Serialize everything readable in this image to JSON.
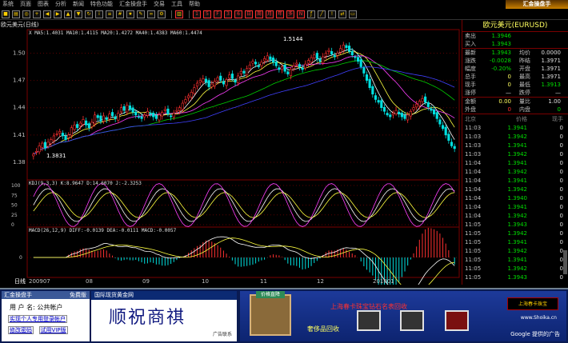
{
  "menu": {
    "items": [
      "系统",
      "页面",
      "图表",
      "分析",
      "新闻",
      "特色功能",
      "汇金操盘手",
      "交易",
      "工具",
      "帮助"
    ],
    "brand": "汇金操盘手"
  },
  "chart_title": "欧元美元(日线)",
  "chart_data": {
    "type": "candlestick",
    "title": "欧元美元(日线)",
    "main_indicator": {
      "label": "X  MA5:1.4031  MA10:1.4115  MA20:1.4272  MA40:1.4383  MA60:1.4474",
      "ma5_label": "MA5:1.4031",
      "ma10_label": "MA10:1.4115",
      "ma20_label": "MA20:1.4272",
      "ma40_label": "MA40:1.4383",
      "ma60_label": "MA60:1.4474"
    },
    "y_ticks": [
      "1.50",
      "1.47",
      "1.44",
      "1.41",
      "1.38"
    ],
    "y_values": [
      1.5,
      1.47,
      1.44,
      1.41,
      1.38
    ],
    "ylim": [
      1.365,
      1.518
    ],
    "high_label": "1.5144",
    "low_label": "1.3831",
    "high": 1.5144,
    "low": 1.3831,
    "x_labels": [
      "日线",
      "200907",
      "08",
      "09",
      "10",
      "11",
      "12",
      "201001"
    ],
    "kdj": {
      "label": "KDJ(9,3,3)  K:8.9647  D:14.6070  J:-2.3253",
      "y_ticks": [
        "100",
        "75",
        "50",
        "25",
        "0"
      ]
    },
    "macd": {
      "label": "MACD(26,12,9)  DIFF:-0.0139  DEA:-0.0111  MACD:-0.0057",
      "y_ticks": [
        "0"
      ]
    },
    "series_close": [
      1.389,
      1.392,
      1.398,
      1.401,
      1.396,
      1.402,
      1.405,
      1.409,
      1.411,
      1.414,
      1.409,
      1.405,
      1.41,
      1.418,
      1.421,
      1.418,
      1.423,
      1.427,
      1.421,
      1.418,
      1.424,
      1.432,
      1.429,
      1.425,
      1.431,
      1.427,
      1.433,
      1.431,
      1.428,
      1.434,
      1.44,
      1.437,
      1.443,
      1.438,
      1.435,
      1.432,
      1.43,
      1.428,
      1.432,
      1.436,
      1.433,
      1.43,
      1.428,
      1.432,
      1.435,
      1.438,
      1.433,
      1.43,
      1.434,
      1.437,
      1.44,
      1.445,
      1.449,
      1.453,
      1.457,
      1.462,
      1.467,
      1.47,
      1.472,
      1.468,
      1.463,
      1.466,
      1.469,
      1.473,
      1.47,
      1.466,
      1.471,
      1.476,
      1.472,
      1.468,
      1.475,
      1.48,
      1.478,
      1.483,
      1.487,
      1.491,
      1.488,
      1.485,
      1.49,
      1.494,
      1.497,
      1.493,
      1.49,
      1.486,
      1.482,
      1.485,
      1.48,
      1.477,
      1.482,
      1.486,
      1.489,
      1.485,
      1.482,
      1.488,
      1.492,
      1.495,
      1.498,
      1.494,
      1.491,
      1.496,
      1.5,
      1.503,
      1.499,
      1.496,
      1.5,
      1.505,
      1.509,
      1.506,
      1.502,
      1.498,
      1.495,
      1.491,
      1.485,
      1.478,
      1.47,
      1.462,
      1.455,
      1.449,
      1.446,
      1.44,
      1.436,
      1.432,
      1.43,
      1.434,
      1.437,
      1.433,
      1.43,
      1.428,
      1.432,
      1.436,
      1.44,
      1.444,
      1.447,
      1.45,
      1.446,
      1.441,
      1.437,
      1.433,
      1.428,
      1.422,
      1.417,
      1.41,
      1.404,
      1.398,
      1.395
    ]
  },
  "quote": {
    "title": "欧元美元(EURUSD)",
    "rows": [
      {
        "l1": "卖出",
        "v1": "1.3946",
        "c1": "green",
        "l2": "",
        "v2": "",
        "c2": "white"
      },
      {
        "l1": "买入",
        "v1": "1.3943",
        "c1": "green",
        "l2": "",
        "v2": "",
        "c2": "white"
      }
    ],
    "rows2": [
      {
        "l1": "最新",
        "v1": "1.3943",
        "c1": "green",
        "l2": "均价",
        "v2": "0.0000",
        "c2": "white"
      },
      {
        "l1": "涨跌",
        "v1": "-0.0028",
        "c1": "green",
        "l2": "昨结",
        "v2": "1.3971",
        "c2": "white"
      },
      {
        "l1": "幅度",
        "v1": "-0.20%",
        "c1": "green",
        "l2": "开盘",
        "v2": "1.3971",
        "c2": "white"
      },
      {
        "l1": "总手",
        "v1": "0",
        "c1": "yellow",
        "l2": "最高",
        "v2": "1.3971",
        "c2": "white"
      },
      {
        "l1": "现手",
        "v1": "0",
        "c1": "yellow",
        "l2": "最低",
        "v2": "1.3913",
        "c2": "green"
      },
      {
        "l1": "涨停",
        "v1": "—",
        "c1": "white",
        "l2": "跌停",
        "v2": "—",
        "c2": "white"
      }
    ],
    "rows3": [
      {
        "l1": "金额",
        "v1": "0.00",
        "c1": "yellow",
        "l2": "量比",
        "v2": "1.00",
        "c2": "white"
      },
      {
        "l1": "外盘",
        "v1": "0",
        "c1": "red",
        "l2": "内盘",
        "v2": "0",
        "c2": "green"
      }
    ],
    "tick_header": {
      "time": "北京",
      "price": "价格",
      "vol": "现手"
    },
    "ticks": [
      {
        "time": "11:03",
        "price": "1.3941",
        "vol": "0"
      },
      {
        "time": "11:03",
        "price": "1.3942",
        "vol": "0"
      },
      {
        "time": "11:03",
        "price": "1.3941",
        "vol": "0"
      },
      {
        "time": "11:03",
        "price": "1.3942",
        "vol": "0"
      },
      {
        "time": "11:04",
        "price": "1.3941",
        "vol": "0"
      },
      {
        "time": "11:04",
        "price": "1.3942",
        "vol": "0"
      },
      {
        "time": "11:04",
        "price": "1.3941",
        "vol": "0"
      },
      {
        "time": "11:04",
        "price": "1.3942",
        "vol": "0"
      },
      {
        "time": "11:04",
        "price": "1.3940",
        "vol": "0"
      },
      {
        "time": "11:04",
        "price": "1.3941",
        "vol": "0"
      },
      {
        "time": "11:04",
        "price": "1.3942",
        "vol": "0"
      },
      {
        "time": "11:05",
        "price": "1.3943",
        "vol": "0"
      },
      {
        "time": "11:05",
        "price": "1.3942",
        "vol": "0"
      },
      {
        "time": "11:05",
        "price": "1.3941",
        "vol": "0"
      },
      {
        "time": "11:05",
        "price": "1.3942",
        "vol": "0"
      },
      {
        "time": "11:05",
        "price": "1.3941",
        "vol": "0"
      },
      {
        "time": "11:05",
        "price": "1.3942",
        "vol": "0"
      },
      {
        "time": "11:05",
        "price": "1.3943",
        "vol": "0"
      }
    ]
  },
  "login": {
    "title": "汇金操盘手",
    "free": "免费版",
    "user": "用 户 名: 公共帐户",
    "link_register": "实现个人专用登录帐户",
    "link_password": "修改密码",
    "link_vip": "试用VIP版"
  },
  "ad_center": {
    "top": "国际现货黄金网",
    "slogan": "顺祝商祺",
    "contact": "广告联系"
  },
  "ad_right": {
    "tag": "价格直降",
    "title": "上海春卡珠宝钻石名表回收",
    "sub": "奢侈品回收",
    "logo": "上海春卡珠宝",
    "site": "www.Shoika.cn",
    "google": "Google 提供的广告"
  }
}
